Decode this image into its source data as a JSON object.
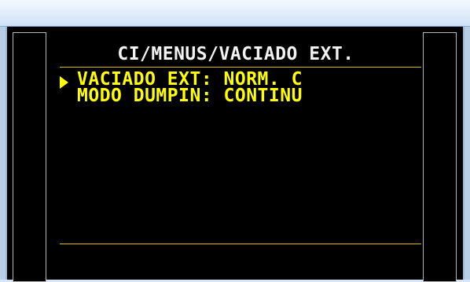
{
  "screen": {
    "title": "CI/MENUS/VACIADO EXT.",
    "items": [
      {
        "label": "VACIADO EXT: NORM. C",
        "selected": true
      },
      {
        "label": "MODO DUMPIN: CONTINU",
        "selected": false
      }
    ]
  },
  "colors": {
    "background": "#000000",
    "title_text": "#f2f2f2",
    "item_text": "#ffff00",
    "rule": "#d8c000",
    "panel_border": "#b9b9b9",
    "window_chrome": "#c9dcf2"
  },
  "icons": {
    "cursor": "triangle-right-icon"
  }
}
